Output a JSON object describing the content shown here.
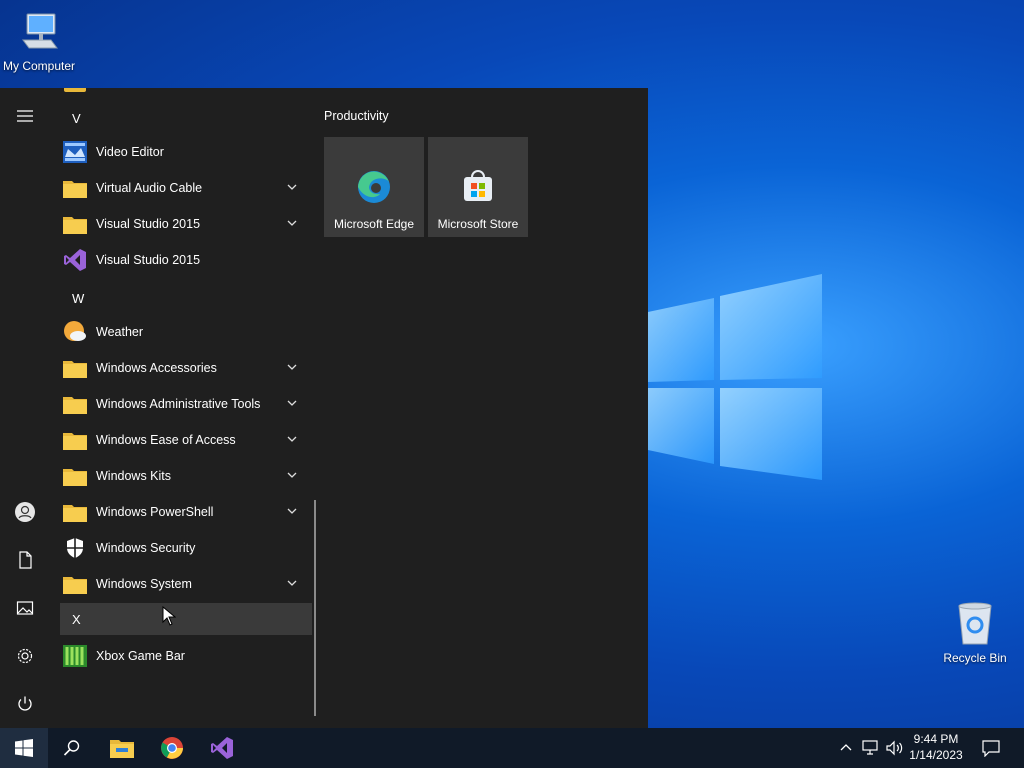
{
  "desktop": {
    "icons": [
      {
        "label": "My Computer"
      },
      {
        "label": "Recycle Bin"
      }
    ]
  },
  "start_menu": {
    "app_list": [
      {
        "type": "letter",
        "label": "V"
      },
      {
        "type": "app",
        "label": "Video Editor",
        "icon": "video-editor-icon",
        "expandable": false
      },
      {
        "type": "folder",
        "label": "Virtual Audio Cable",
        "icon": "folder-icon",
        "expandable": true
      },
      {
        "type": "folder",
        "label": "Visual Studio 2015",
        "icon": "folder-icon",
        "expandable": true
      },
      {
        "type": "app",
        "label": "Visual Studio 2015",
        "icon": "visual-studio-icon",
        "expandable": false
      },
      {
        "type": "letter",
        "label": "W"
      },
      {
        "type": "app",
        "label": "Weather",
        "icon": "weather-icon",
        "expandable": false
      },
      {
        "type": "folder",
        "label": "Windows Accessories",
        "icon": "folder-icon",
        "expandable": true
      },
      {
        "type": "folder",
        "label": "Windows Administrative Tools",
        "icon": "folder-icon",
        "expandable": true
      },
      {
        "type": "folder",
        "label": "Windows Ease of Access",
        "icon": "folder-icon",
        "expandable": true
      },
      {
        "type": "folder",
        "label": "Windows Kits",
        "icon": "folder-icon",
        "expandable": true
      },
      {
        "type": "folder",
        "label": "Windows PowerShell",
        "icon": "folder-icon",
        "expandable": true
      },
      {
        "type": "app",
        "label": "Windows Security",
        "icon": "shield-icon",
        "expandable": false
      },
      {
        "type": "folder",
        "label": "Windows System",
        "icon": "folder-icon",
        "expandable": true
      },
      {
        "type": "letter",
        "label": "X"
      },
      {
        "type": "app",
        "label": "Xbox Game Bar",
        "icon": "xbox-game-bar-icon",
        "expandable": false
      }
    ],
    "tile_group": {
      "title": "Productivity",
      "tiles": [
        {
          "label": "Microsoft Edge",
          "icon": "edge-icon"
        },
        {
          "label": "Microsoft Store",
          "icon": "store-icon"
        }
      ]
    },
    "rail": [
      "hamburger-icon",
      "user-icon",
      "documents-icon",
      "pictures-icon",
      "settings-icon",
      "power-icon"
    ]
  },
  "taskbar": {
    "pinned": [
      "start-icon",
      "search-icon",
      "file-explorer-icon",
      "chrome-icon",
      "visual-studio-icon"
    ],
    "clock": {
      "time": "9:44 PM",
      "date": "1/14/2023"
    }
  },
  "colors": {
    "accent": "#0078d7",
    "start_bg": "#1f1f1f",
    "tile_bg": "#3b3b3b",
    "taskbar_bg": "#101a28"
  }
}
